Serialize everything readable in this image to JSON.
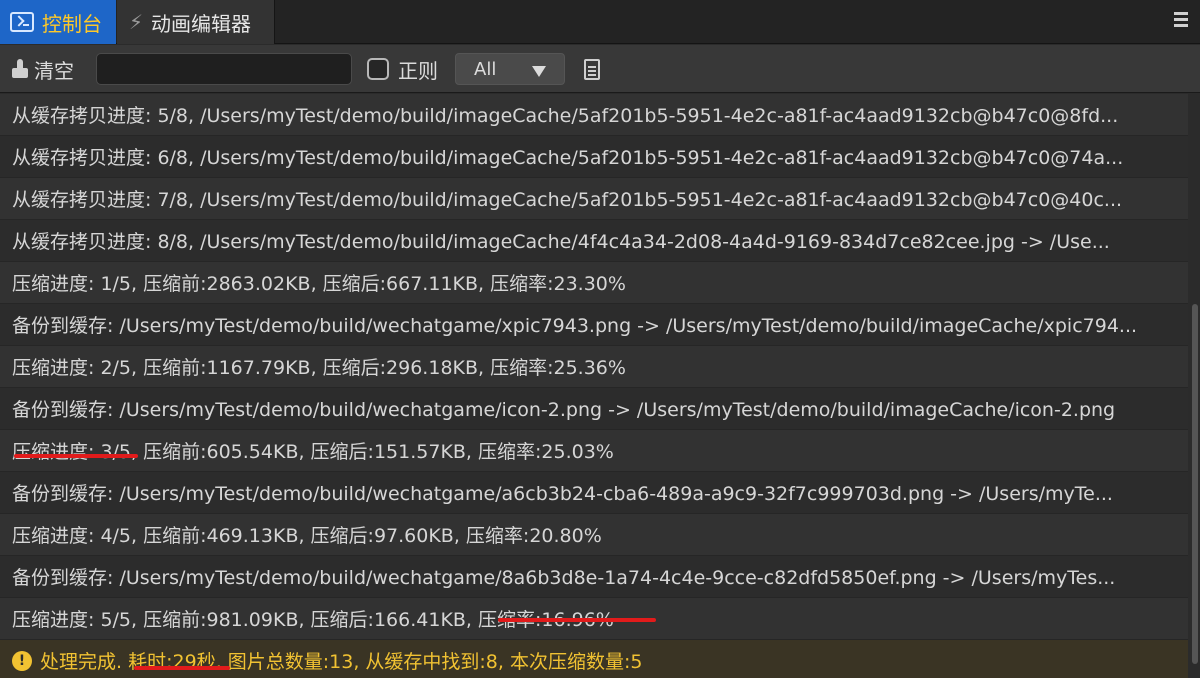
{
  "tabs": {
    "console_label": "控制台",
    "anim_label": "动画编辑器"
  },
  "toolbar": {
    "clear_label": "清空",
    "search_value": "",
    "regex_label": "正则",
    "filter_value": "All"
  },
  "log": {
    "rows": [
      "从缓存拷贝进度: 5/8, /Users/myTest/demo/build/imageCache/5af201b5-5951-4e2c-a81f-ac4aad9132cb@b47c0@8fd...",
      "从缓存拷贝进度: 6/8, /Users/myTest/demo/build/imageCache/5af201b5-5951-4e2c-a81f-ac4aad9132cb@b47c0@74a...",
      "从缓存拷贝进度: 7/8, /Users/myTest/demo/build/imageCache/5af201b5-5951-4e2c-a81f-ac4aad9132cb@b47c0@40c...",
      "从缓存拷贝进度: 8/8, /Users/myTest/demo/build/imageCache/4f4c4a34-2d08-4a4d-9169-834d7ce82cee.jpg -> /Use...",
      "压缩进度: 1/5, 压缩前:2863.02KB, 压缩后:667.11KB, 压缩率:23.30%",
      "备份到缓存: /Users/myTest/demo/build/wechatgame/xpic7943.png -> /Users/myTest/demo/build/imageCache/xpic794...",
      "压缩进度: 2/5, 压缩前:1167.79KB, 压缩后:296.18KB, 压缩率:25.36%",
      "备份到缓存: /Users/myTest/demo/build/wechatgame/icon-2.png -> /Users/myTest/demo/build/imageCache/icon-2.png",
      "压缩进度: 3/5, 压缩前:605.54KB, 压缩后:151.57KB, 压缩率:25.03%",
      "备份到缓存: /Users/myTest/demo/build/wechatgame/a6cb3b24-cba6-489a-a9c9-32f7c999703d.png -> /Users/myTe...",
      "压缩进度: 4/5, 压缩前:469.13KB, 压缩后:97.60KB, 压缩率:20.80%",
      "备份到缓存: /Users/myTest/demo/build/wechatgame/8a6b3d8e-1a74-4c4e-9cce-c82dfd5850ef.png -> /Users/myTes...",
      "压缩进度: 5/5, 压缩前:981.09KB, 压缩后:166.41KB, 压缩率:16.96%"
    ],
    "warning": "处理完成. 耗时:29秒, 图片总数量:13, 从缓存中找到:8, 本次压缩数量:5"
  },
  "colors": {
    "tab_active_bg": "#1e66c8",
    "tab_active_text": "#ffc928",
    "warning_text": "#f1c232",
    "annotation": "#e11b1b"
  }
}
